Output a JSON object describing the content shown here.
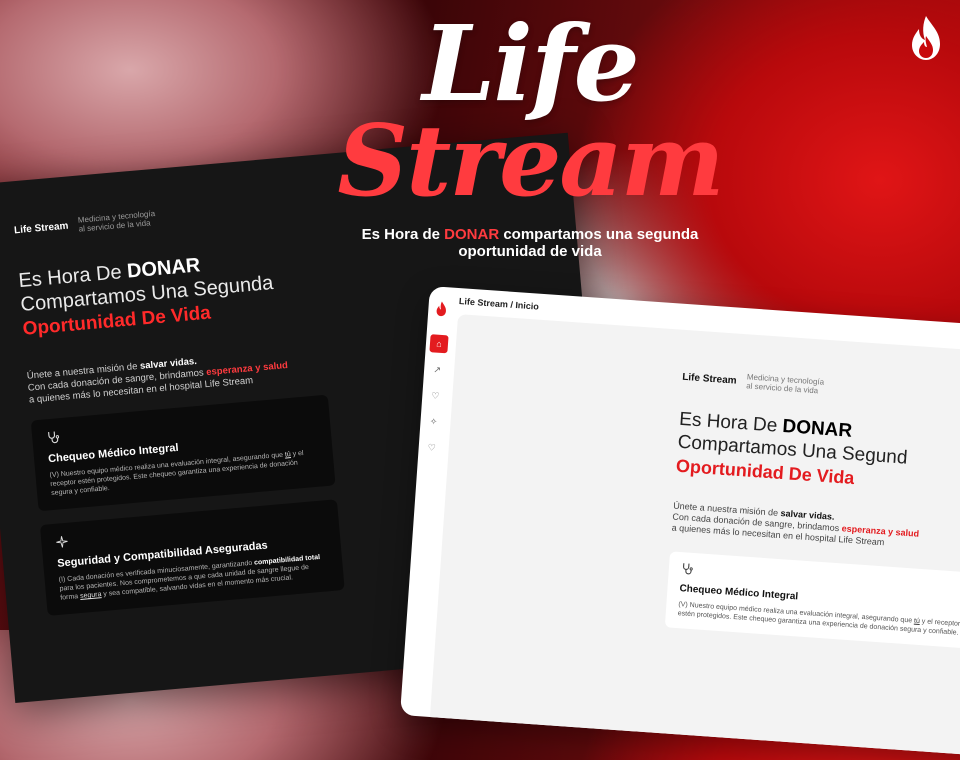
{
  "hero": {
    "title_line1": "Life",
    "title_line2": "Stream",
    "tagline_prefix": "Es Hora de ",
    "tagline_highlight": "DONAR",
    "tagline_suffix": " compartamos una segunda oportunidad de vida"
  },
  "brand": {
    "icon": "flame-icon"
  },
  "colors": {
    "accent": "#e31b1f",
    "dark_bg": "#161616",
    "light_bg": "#f3f3f3"
  },
  "left_screen": {
    "logo_name": "Life Stream",
    "logo_sub": "Medicina y tecnología al servicio de la vida",
    "heading_pre": "Es Hora De ",
    "heading_bold": "DONAR",
    "heading_line2": "Compartamos Una Segunda",
    "heading_red": "Oportunidad De Vida",
    "intro_a": "Únete a nuestra misión de ",
    "intro_b": "salvar vidas.",
    "intro_c": "Con cada donación de sangre, brindamos ",
    "intro_d": "esperanza y salud",
    "intro_e": "a quienes más lo necesitan en el hospital Life Stream",
    "card1": {
      "icon": "stethoscope-icon",
      "title": "Chequeo Médico Integral",
      "text_a": "(V) Nuestro equipo médico realiza una evaluación integral, asegurando que ",
      "text_u": "tú",
      "text_b": " y el receptor estén protegidos. Este chequeo garantiza una experiencia de donación segura y confiable."
    },
    "card2": {
      "icon": "sparkle-icon",
      "title": "Seguridad y Compatibilidad Aseguradas",
      "text_a": "(I) Cada donación es verificada minuciosamente, garantizando ",
      "text_bold": "compatibilidad total",
      "text_b": " para los pacientes. Nos comprometemos a que cada unidad de sangre llegue de forma ",
      "text_u": "segura",
      "text_c": " y sea compatible, salvando vidas en el momento más crucial."
    }
  },
  "right_screen": {
    "breadcrumb": "Life Stream / Inicio",
    "nav": [
      "home-icon",
      "chart-icon",
      "heart-check-icon",
      "sparkle-icon",
      "heart-icon"
    ],
    "logo_name": "Life Stream",
    "logo_sub": "Medicina y tecnología al servicio de la vida",
    "heading_pre": "Es Hora De ",
    "heading_bold": "DONAR",
    "heading_line2": "Compartamos Una Segund",
    "heading_red": "Oportunidad De Vida",
    "intro_a": "Únete a nuestra misión de ",
    "intro_b": "salvar vidas.",
    "intro_c": "Con cada donación de sangre, brindamos ",
    "intro_d": "esperanza y salud",
    "intro_e": "a quienes más lo necesitan en el hospital Life Stream",
    "card1": {
      "icon": "stethoscope-icon",
      "title": "Chequeo Médico Integral",
      "text_a": "(V) Nuestro equipo médico realiza una evaluación integral, asegurando que ",
      "text_u": "tú",
      "text_b": " y el receptor estén protegidos. Este chequeo garantiza una experiencia de donación segura y confiable."
    }
  }
}
